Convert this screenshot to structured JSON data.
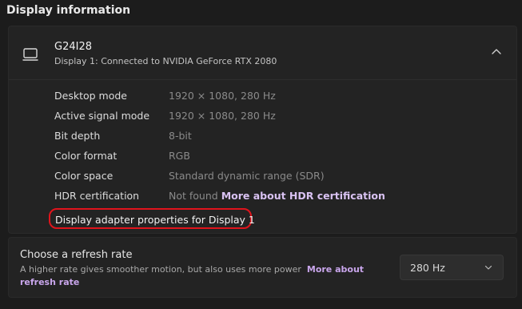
{
  "section": {
    "title": "Display information"
  },
  "display": {
    "name": "G24I28",
    "subtitle": "Display 1: Connected to NVIDIA GeForce RTX 2080",
    "icon": "monitor-icon",
    "collapse_icon": "chevron-up-icon"
  },
  "info": [
    {
      "label": "Desktop mode",
      "value": "1920 × 1080, 280 Hz"
    },
    {
      "label": "Active signal mode",
      "value": "1920 × 1080, 280 Hz"
    },
    {
      "label": "Bit depth",
      "value": "8-bit"
    },
    {
      "label": "Color format",
      "value": "RGB"
    },
    {
      "label": "Color space",
      "value": "Standard dynamic range (SDR)"
    },
    {
      "label": "HDR certification",
      "value": "Not found",
      "link": "More about HDR certification"
    }
  ],
  "adapter_link": "Display adapter properties for Display 1",
  "refresh": {
    "title": "Choose a refresh rate",
    "desc": "A higher rate gives smoother motion, but also uses more power",
    "link": "More about refresh rate",
    "selected": "280 Hz"
  },
  "colors": {
    "highlight": "#e0141c",
    "link": "#d9c2f2",
    "background": "#1c1c1c"
  }
}
